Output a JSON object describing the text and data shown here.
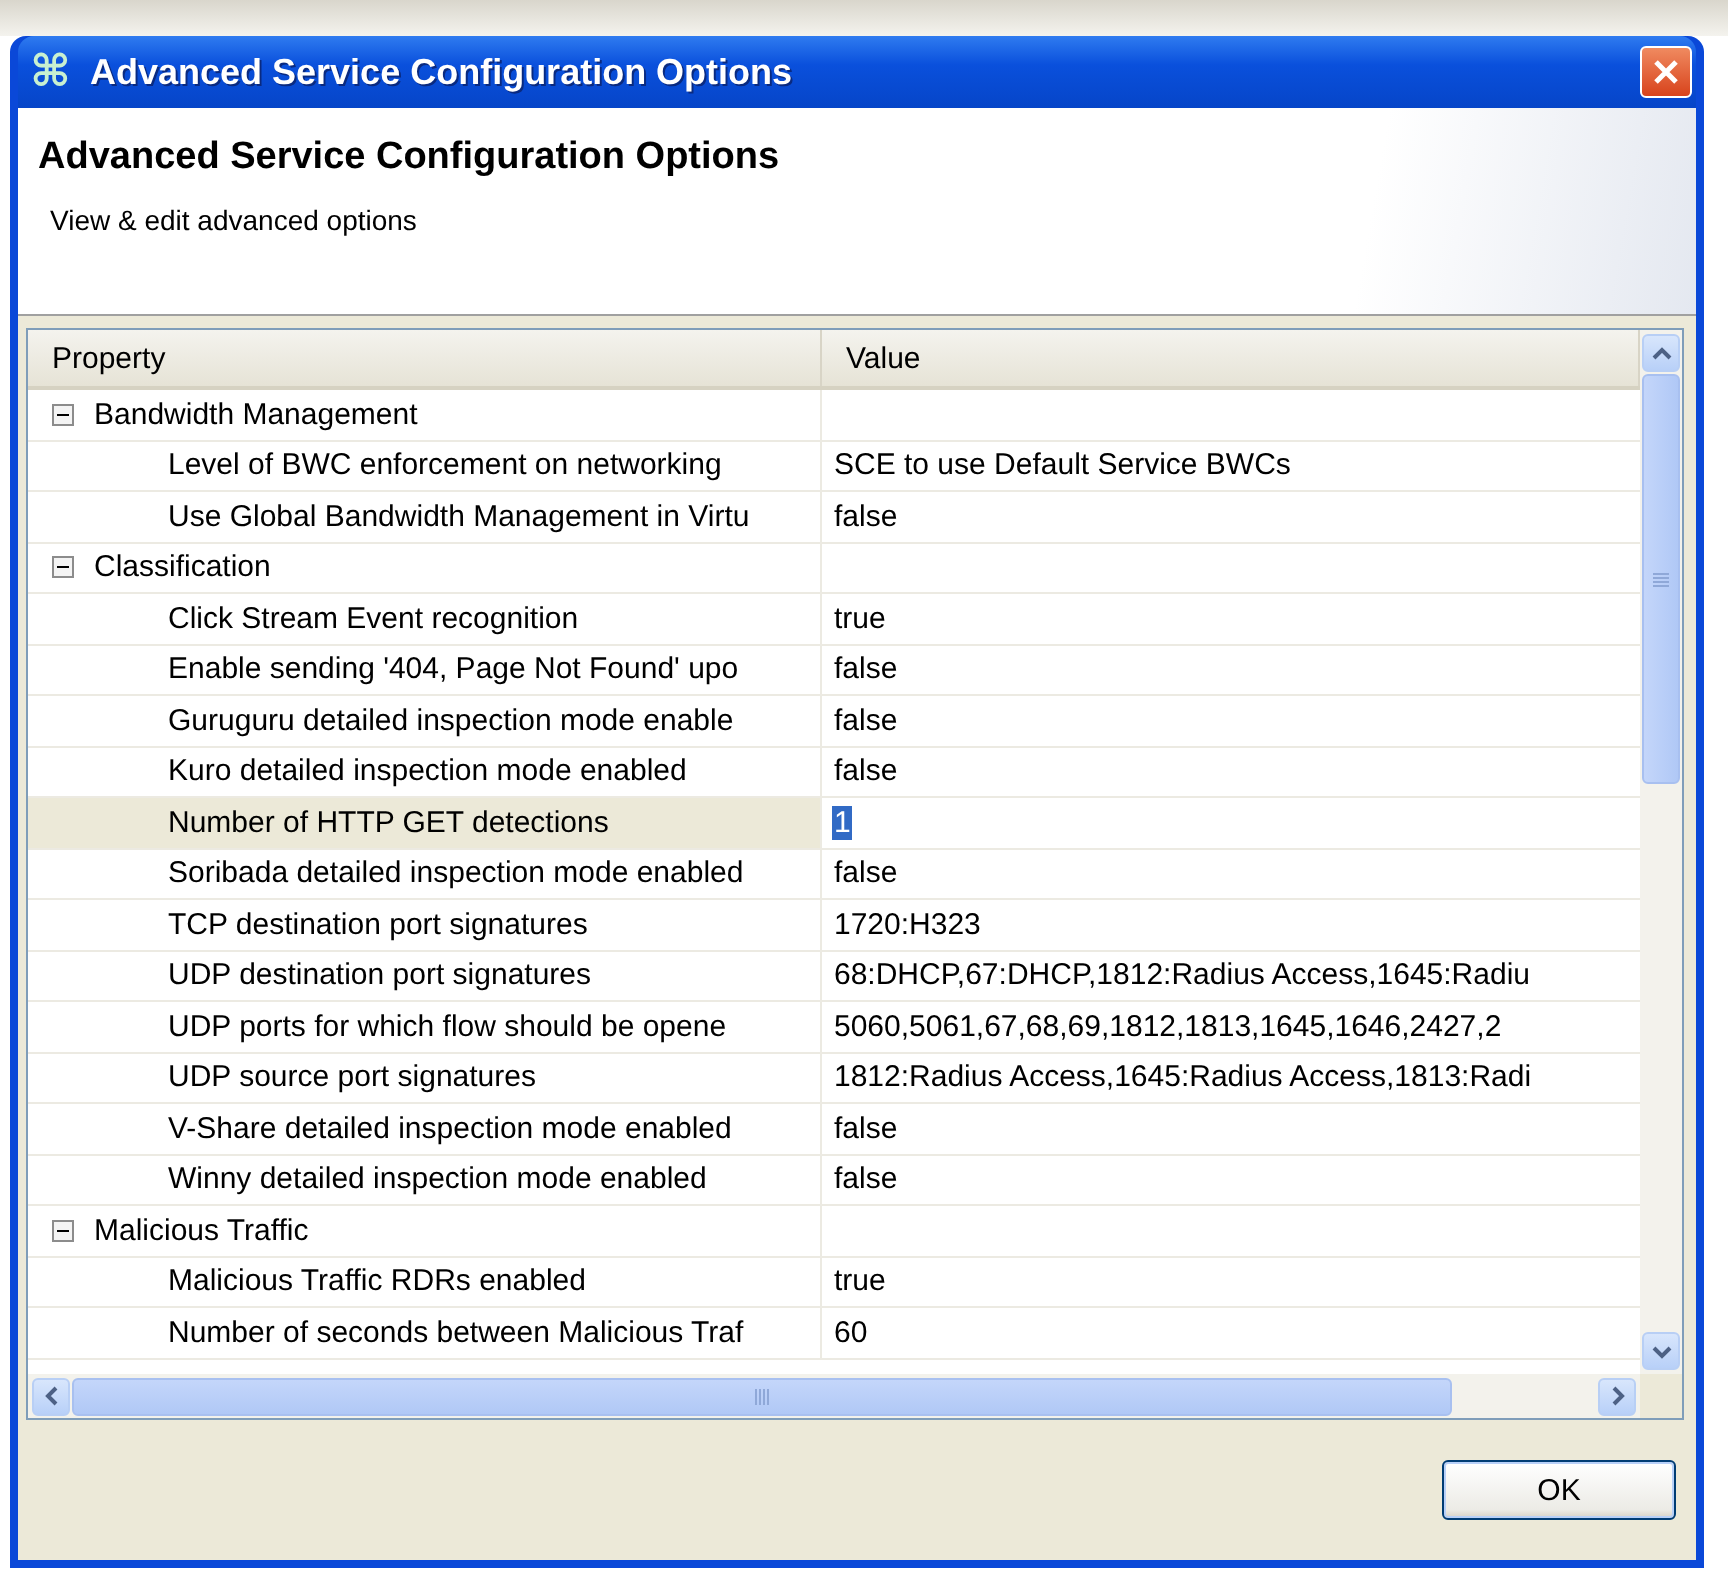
{
  "window": {
    "icon": "⌘",
    "title": "Advanced Service Configuration Options"
  },
  "header": {
    "title": "Advanced Service Configuration Options",
    "subtitle": "View & edit advanced options"
  },
  "table": {
    "columns": [
      "Property",
      "Value"
    ],
    "groups": [
      {
        "label": "Bandwidth Management",
        "expanded": true,
        "selected": false,
        "children": [
          {
            "property": "Level of BWC enforcement on networking",
            "value": "SCE to use Default Service BWCs",
            "selected": false
          },
          {
            "property": "Use Global Bandwidth Management in Virtu",
            "value": "false",
            "selected": false
          }
        ]
      },
      {
        "label": "Classification",
        "expanded": true,
        "selected": false,
        "children": [
          {
            "property": "Click Stream Event recognition",
            "value": "true",
            "selected": false
          },
          {
            "property": "Enable sending '404, Page Not Found' upo",
            "value": "false",
            "selected": false
          },
          {
            "property": "Guruguru detailed inspection mode enable",
            "value": "false",
            "selected": false
          },
          {
            "property": "Kuro detailed inspection mode enabled",
            "value": "false",
            "selected": false
          },
          {
            "property": "Number of HTTP GET detections",
            "value": "1",
            "selected": true
          },
          {
            "property": "Soribada detailed inspection mode enabled",
            "value": "false",
            "selected": false
          },
          {
            "property": "TCP destination port signatures",
            "value": "1720:H323",
            "selected": false
          },
          {
            "property": "UDP destination port signatures",
            "value": "68:DHCP,67:DHCP,1812:Radius Access,1645:Radiu",
            "selected": false
          },
          {
            "property": "UDP ports for which flow should be opene",
            "value": "5060,5061,67,68,69,1812,1813,1645,1646,2427,2",
            "selected": false
          },
          {
            "property": "UDP source port signatures",
            "value": "1812:Radius Access,1645:Radius Access,1813:Radi",
            "selected": false
          },
          {
            "property": "V-Share detailed inspection mode enabled",
            "value": "false",
            "selected": false
          },
          {
            "property": "Winny detailed inspection mode enabled",
            "value": "false",
            "selected": false
          }
        ]
      },
      {
        "label": "Malicious Traffic",
        "expanded": true,
        "selected": false,
        "children": [
          {
            "property": "Malicious Traffic RDRs enabled",
            "value": "true",
            "selected": false
          },
          {
            "property": "Number of seconds between Malicious Traf",
            "value": "60",
            "selected": false
          }
        ]
      }
    ]
  },
  "buttons": [
    "OK"
  ]
}
